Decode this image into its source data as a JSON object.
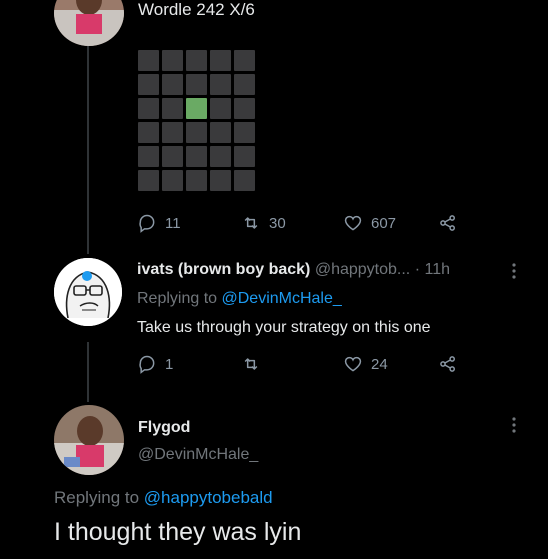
{
  "tweet1": {
    "text": "Wordle 242 X/6",
    "wordle": {
      "rows": 6,
      "cols": 5,
      "green_cell": {
        "row": 2,
        "col": 2
      }
    },
    "actions": {
      "replies": "11",
      "retweets": "30",
      "likes": "607"
    }
  },
  "tweet2": {
    "display_name": "ivats (brown boy back)",
    "handle": "@happytob...",
    "time": "· 11h",
    "replying_prefix": "Replying to",
    "replying_to": "@DevinMcHale_",
    "text": "Take us through your strategy on this one",
    "actions": {
      "replies": "1",
      "retweets": "",
      "likes": "24"
    }
  },
  "tweet3": {
    "display_name": "Flygod",
    "handle": "@DevinMcHale_",
    "replying_prefix": "Replying to",
    "replying_to": "@happytobebald",
    "text": "I thought they was lyin"
  },
  "icons": {
    "reply": "reply-icon",
    "retweet": "retweet-icon",
    "like": "heart-icon",
    "share": "share-icon",
    "more": "more-icon"
  },
  "colors": {
    "background": "#000000",
    "link": "#1d9bf0",
    "wordle_green": "#6aaa64",
    "wordle_gray": "#3a3a3c"
  }
}
